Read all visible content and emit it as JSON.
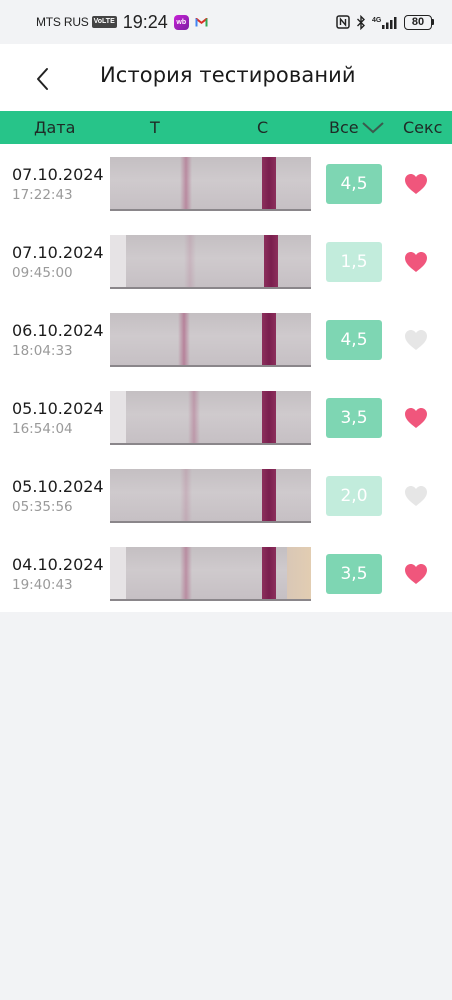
{
  "status_bar": {
    "carrier": "MTS RUS",
    "volte": "VoLTE",
    "time": "19:24",
    "wb_badge": "wb",
    "network": "4G",
    "battery": "80"
  },
  "header": {
    "title": "История тестирований",
    "back_icon": "chevron-left-icon"
  },
  "columns": {
    "date": "Дата",
    "t": "T",
    "c": "C",
    "all": "Все",
    "sex": "Секс"
  },
  "colors": {
    "accent_green": "#27c489",
    "score_dark": "#7ed6b3",
    "score_light": "#c2ecdc",
    "heart_active": "#f0567c",
    "heart_inactive": "#e6e6e6"
  },
  "rows": [
    {
      "date": "07.10.2024",
      "time": "17:22:43",
      "score": "4,5",
      "score_style": "dark",
      "sex": true
    },
    {
      "date": "07.10.2024",
      "time": "09:45:00",
      "score": "1,5",
      "score_style": "light",
      "sex": true
    },
    {
      "date": "06.10.2024",
      "time": "18:04:33",
      "score": "4,5",
      "score_style": "dark",
      "sex": false
    },
    {
      "date": "05.10.2024",
      "time": "16:54:04",
      "score": "3,5",
      "score_style": "dark",
      "sex": true
    },
    {
      "date": "05.10.2024",
      "time": "05:35:56",
      "score": "2,0",
      "score_style": "light",
      "sex": false
    },
    {
      "date": "04.10.2024",
      "time": "19:40:43",
      "score": "3,5",
      "score_style": "dark",
      "sex": true
    }
  ]
}
